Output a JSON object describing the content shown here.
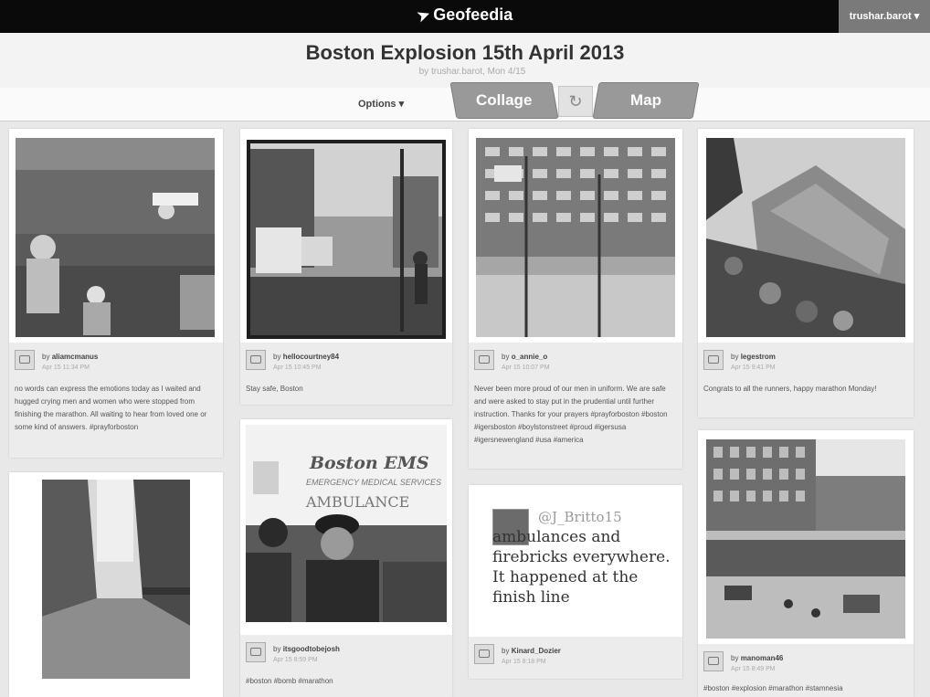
{
  "app": {
    "brand": "Geofeedia",
    "user": "trushar.barot"
  },
  "header": {
    "title": "Boston Explosion 15th April 2013",
    "subtitle": "by trushar.barot, Mon 4/15"
  },
  "toolbar": {
    "options": "Options ▾",
    "collage": "Collage",
    "map": "Map",
    "refresh_icon": "refresh-icon"
  },
  "posts": [
    {
      "user": "aliamcmanus",
      "date": "Apr 15 11:34 PM",
      "caption": "no words can express the emotions today as I waited and hugged crying men and women who were stopped from finishing the marathon. All waiting to hear from loved one or some kind of answers. #prayforboston"
    },
    {
      "user": "hellocourtney84",
      "date": "Apr 15 10:45 PM",
      "caption": "Stay safe, Boston"
    },
    {
      "user": "o_annie_o",
      "date": "Apr 15 10:07 PM",
      "caption": "Never been more proud of our men in uniform. We are safe and were asked to stay put in the prudential until further instruction. Thanks for your prayers #prayforboston #boston #igersboston #boylstonstreet #proud #igersusa #igersnewengland #usa #america"
    },
    {
      "user": "legestrom",
      "date": "Apr 15 9:41 PM",
      "caption": "Congrats to all the runners, happy marathon Monday!"
    },
    {
      "user": "itsgoodtobejosh",
      "date": "Apr 15 8:59 PM",
      "caption": "#boston #bomb #marathon"
    },
    {
      "user": "Kinard_Dozier",
      "date": "Apr 15 8:18 PM",
      "caption": ""
    },
    {
      "user": "manoman46",
      "date": "Apr 15 8:49 PM",
      "caption": "#boston #explosion #marathon #stamnesia"
    }
  ],
  "tweet": {
    "handle": "@J_Britto15",
    "text": "ambulances and firebricks everywhere. It happened at the finish line"
  },
  "photo_text": {
    "ems": "Boston EMS",
    "ems_sub": "EMERGENCY MEDICAL SERVICES",
    "ambulance": "AMBULANCE"
  },
  "labels": {
    "by": "by"
  }
}
